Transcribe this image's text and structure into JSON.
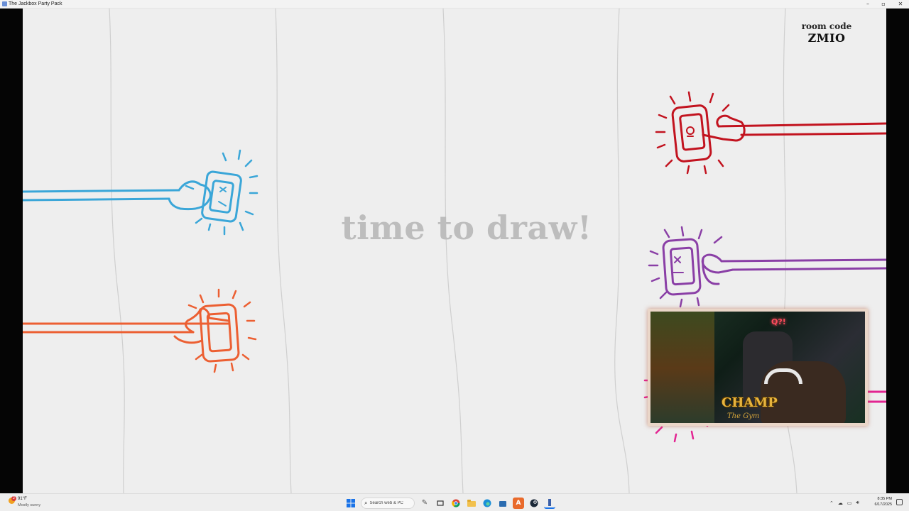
{
  "window": {
    "title": "The Jackbox Party Pack",
    "controls": {
      "minimize": "–",
      "maximize": "▫",
      "close": "✕"
    }
  },
  "game": {
    "room_code_label": "room code",
    "room_code": "ZMIO",
    "headline": "time to draw!",
    "player_colors": {
      "blue": "#3aa6d8",
      "orange": "#ec5f32",
      "red": "#c2131f",
      "purple": "#8a3fa6",
      "pink": "#e32592"
    }
  },
  "webcam": {
    "neon_sign": "Q?!",
    "overlay_title": "CHAMP",
    "overlay_subtitle": "The Gym"
  },
  "taskbar": {
    "weather_badge": "2",
    "weather_temp": "91°F",
    "weather_condition": "Mostly sunny",
    "search_placeholder": "Search web & PC",
    "clock_time": "8:35 PM",
    "clock_date": "6/17/2025"
  }
}
